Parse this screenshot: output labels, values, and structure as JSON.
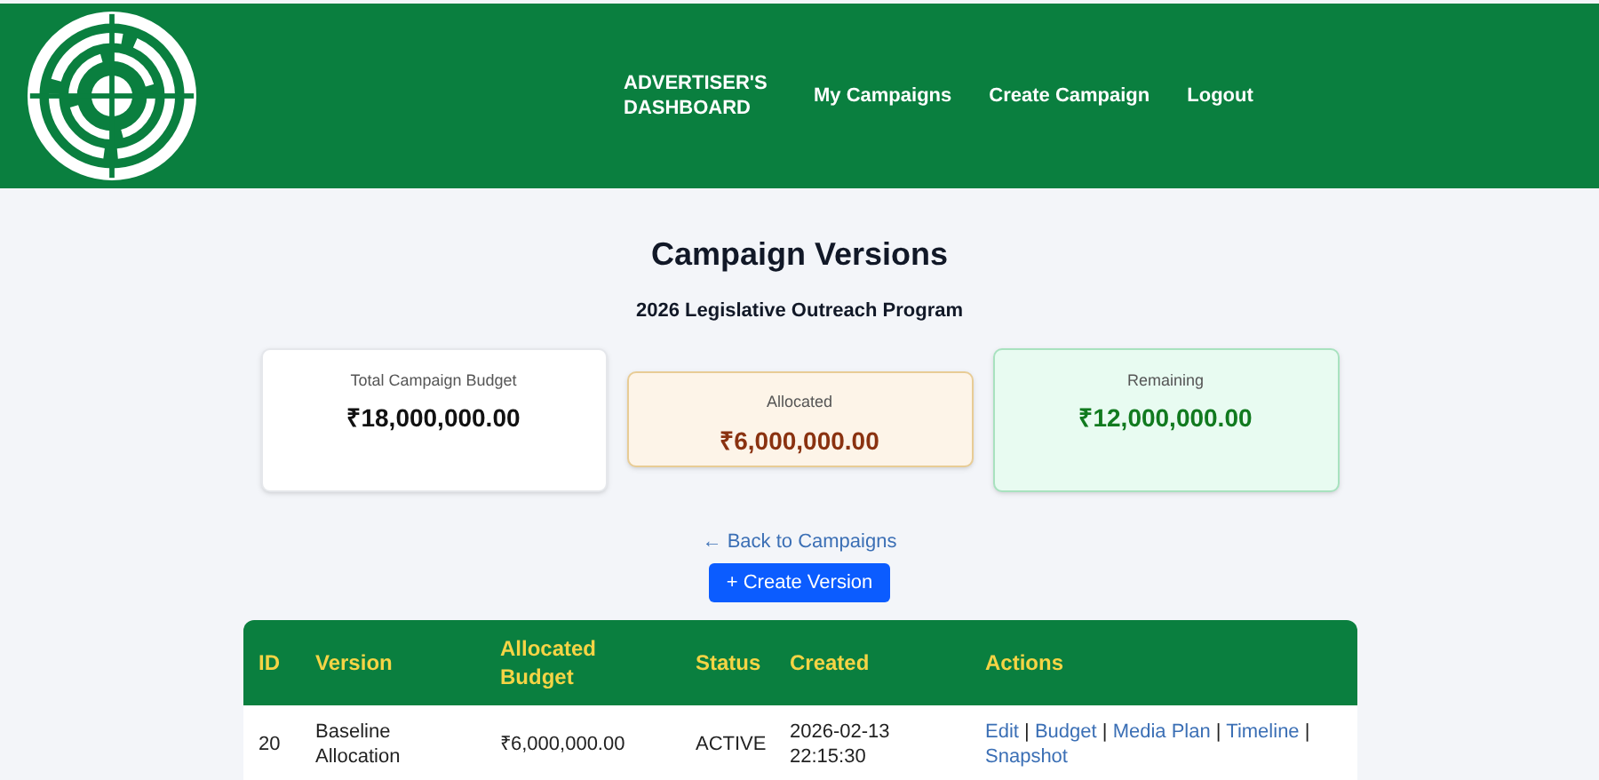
{
  "nav": {
    "brand": "ADVERTISER'S DASHBOARD",
    "links": [
      "My Campaigns",
      "Create Campaign",
      "Logout"
    ]
  },
  "title": "Campaign Versions",
  "subtitle": "2026 Legislative Outreach Program",
  "cards": [
    {
      "kind": "neutral",
      "label": "Total Campaign Budget",
      "value": "₹18,000,000.00"
    },
    {
      "kind": "warning",
      "label": "Allocated",
      "value": "₹6,000,000.00"
    },
    {
      "kind": "success",
      "label": "Remaining",
      "value": "₹12,000,000.00"
    }
  ],
  "back_link": "← Back to Campaigns",
  "create_button": "+ Create Version",
  "table": {
    "columns": [
      "ID",
      "Version",
      "Allocated Budget",
      "Status",
      "Created",
      "Actions"
    ],
    "rows": [
      {
        "id": "20",
        "version": "Baseline Allocation",
        "allocated_budget": "₹6,000,000.00",
        "status": "ACTIVE",
        "created": "2026-02-13 22:15:30",
        "actions": [
          "Edit",
          "Budget",
          "Media Plan",
          "Timeline",
          "Snapshot"
        ],
        "separator": "|"
      }
    ]
  }
}
